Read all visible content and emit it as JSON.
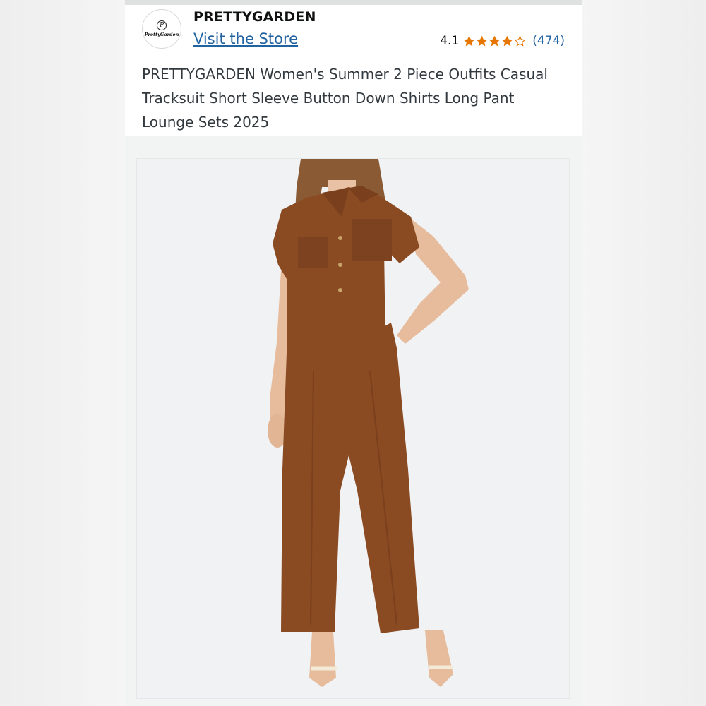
{
  "store": {
    "logo_text": "PrettyGarden",
    "brand_name": "PRETTYGARDEN",
    "visit_link": "Visit the Store"
  },
  "rating": {
    "value": "4.1",
    "stars": 4.1,
    "review_count": "(474)",
    "star_color": "#e77600"
  },
  "product": {
    "title": "PRETTYGARDEN Women's Summer 2 Piece Outfits Casual Tracksuit Short Sleeve Button Down Shirts Long Pant Lounge Sets 2025",
    "outfit_color": "#8a4a22"
  },
  "icons": [
    "store-logo-icon",
    "star-icon"
  ]
}
